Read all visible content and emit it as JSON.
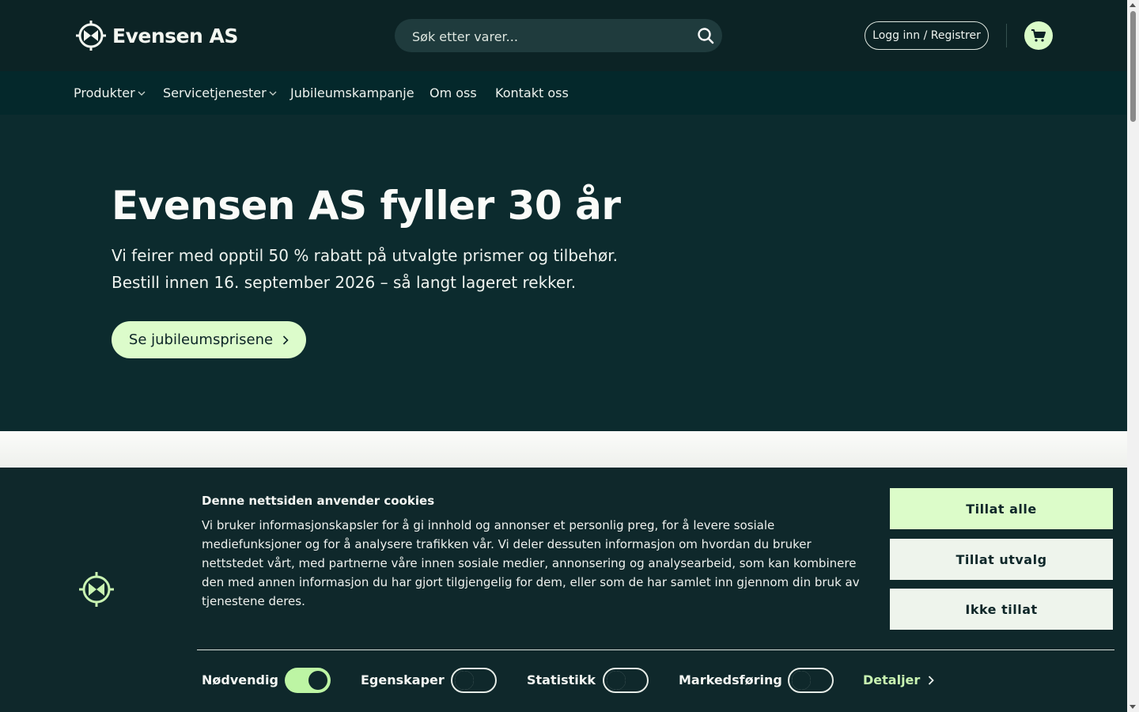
{
  "header": {
    "logo_text": "Evensen AS",
    "search_placeholder": "Søk etter varer...",
    "login_label": "Logg inn / Registrer"
  },
  "nav": {
    "items": [
      {
        "label": "Produkter",
        "has_dropdown": true
      },
      {
        "label": "Servicetjenester",
        "has_dropdown": true
      },
      {
        "label": "Jubileumskampanje",
        "has_dropdown": false
      },
      {
        "label": "Om oss",
        "has_dropdown": false
      },
      {
        "label": "Kontakt oss",
        "has_dropdown": false
      }
    ]
  },
  "hero": {
    "title": "Evensen AS fyller 30 år",
    "line1": "Vi feirer med opptil 50 % rabatt på utvalgte prismer og tilbehør.",
    "line2": "Bestill innen 16. september 2026 – så langt lageret rekker.",
    "cta_label": "Se jubileumsprisene"
  },
  "cookie": {
    "title": "Denne nettsiden anvender cookies",
    "text": "Vi bruker informasjonskapsler for å gi innhold og annonser et personlig preg, for å levere sosiale mediefunksjoner og for å analysere trafikken vår. Vi deler dessuten informasjon om hvordan du bruker nettstedet vårt, med partnerne våre innen sosiale medier, annonsering og analysearbeid, som kan kombinere den med annen informasjon du har gjort tilgjengelig for dem, eller som de har samlet inn gjennom din bruk av tjenestene deres.",
    "allow_all": "Tillat alle",
    "allow_selection": "Tillat utvalg",
    "deny": "Ikke tillat",
    "toggles": [
      {
        "label": "Nødvendig",
        "on": true
      },
      {
        "label": "Egenskaper",
        "on": false
      },
      {
        "label": "Statistikk",
        "on": false
      },
      {
        "label": "Markedsføring",
        "on": false
      }
    ],
    "details_label": "Detaljer"
  },
  "colors": {
    "accent": "#dcfcc9",
    "header_bg": "#0c2325",
    "nav_bg": "#04282b",
    "hero_bg": "#0c2b2e",
    "cookie_bg": "#0f282b"
  }
}
